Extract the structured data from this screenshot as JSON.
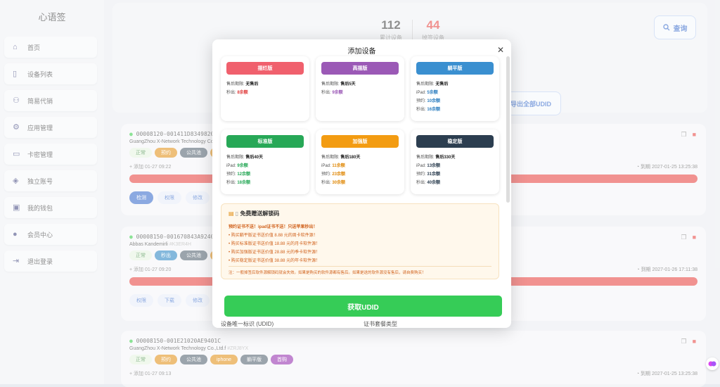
{
  "sidebar": {
    "brand": "心语签",
    "items": [
      {
        "label": "首页",
        "icon": "home-icon"
      },
      {
        "label": "设备列表",
        "icon": "phone-icon"
      },
      {
        "label": "简易代销",
        "icon": "users-icon"
      },
      {
        "label": "应用管理",
        "icon": "apps-icon"
      },
      {
        "label": "卡密管理",
        "icon": "card-icon"
      },
      {
        "label": "独立账号",
        "icon": "layers-icon"
      },
      {
        "label": "我的钱包",
        "icon": "wallet-icon"
      },
      {
        "label": "会员中心",
        "icon": "user-icon"
      },
      {
        "label": "退出登录",
        "icon": "logout-icon"
      }
    ]
  },
  "stats": {
    "total": {
      "value": "112",
      "label": "累计设备"
    },
    "dropped": {
      "value": "44",
      "label": "掉签设备"
    }
  },
  "buttons": {
    "query": "查询",
    "export": "导出全部UDID"
  },
  "devices": [
    {
      "id": "00008120-001411D834982015",
      "company": "GuangZhou X-Network Technology Co.,Ltd.f",
      "tags": [
        {
          "t": "正常",
          "c": "#7cc46f",
          "fg": "#2e7d32",
          "light": true
        },
        {
          "t": "预约",
          "c": "#e08a0b"
        },
        {
          "t": "公共池",
          "c": "#4a5a68"
        },
        {
          "t": "",
          "c": "#e08a0b"
        }
      ],
      "added": "+ 添加 01-27 09:22",
      "expire": "到期 2027-01-25 13:25:38",
      "btns": [
        "检测",
        "权限",
        "修改"
      ]
    },
    {
      "id": "00008150-001670843A924015",
      "company": "Abbas Kandemirli",
      "company_code": "#K3ER4H",
      "tags": [
        {
          "t": "正常",
          "c": "#7cc46f",
          "fg": "#2e7d32",
          "light": true
        },
        {
          "t": "秒出",
          "c": "#1f7fbf"
        },
        {
          "t": "公共池",
          "c": "#4a5a68"
        },
        {
          "t": "",
          "c": "#e08a0b"
        }
      ],
      "added": "+ 添加 01-27 09:20",
      "expire": "到期 2027-01-26 17:11:38",
      "btns": [
        "权限",
        "下载",
        "修改"
      ]
    },
    {
      "id": "00008150-001E21020AE9401C",
      "company": "GuangZhou X-Network Technology Co.,Ltd.f",
      "company_code": "#ZRJ8YX",
      "tags": [
        {
          "t": "正常",
          "c": "#7cc46f",
          "fg": "#2e7d32",
          "light": true
        },
        {
          "t": "预约",
          "c": "#e08a0b"
        },
        {
          "t": "公共池",
          "c": "#4a5a68"
        },
        {
          "t": "iphone",
          "c": "#e08a0b"
        },
        {
          "t": "躺平版",
          "c": "#4a5a68"
        },
        {
          "t": "首购",
          "c": "#8e24aa"
        }
      ],
      "added": "+ 添加 01-27 09:13",
      "expire": "到期 2027-01-25 13:25:38"
    }
  ],
  "modal": {
    "title": "添加设备",
    "plans": [
      {
        "name": "摆烂版",
        "color": "#f0606d",
        "lines": [
          [
            "售后期限:",
            "无售后",
            "#222"
          ],
          [
            "秒出:",
            "8余额",
            "#e04040"
          ]
        ]
      },
      {
        "name": "高摆版",
        "color": "#9b59b6",
        "lines": [
          [
            "售后期限:",
            "售后5天",
            "#222"
          ],
          [
            "秒出:",
            "9余额",
            "#9b59b6"
          ]
        ]
      },
      {
        "name": "躺平版",
        "color": "#3a8fd0",
        "lines": [
          [
            "售后期限:",
            "无售后",
            "#222"
          ],
          [
            "iPad:",
            "5余额",
            "#2f7fc0"
          ],
          [
            "预约:",
            "10余额",
            "#2f7fc0"
          ],
          [
            "秒出:",
            "16余额",
            "#2f7fc0"
          ]
        ]
      },
      {
        "name": "标准版",
        "color": "#27a857",
        "lines": [
          [
            "售后期限:",
            "售后40天",
            "#222"
          ],
          [
            "iPad:",
            "9余额",
            "#27a857"
          ],
          [
            "预约:",
            "12余额",
            "#27a857"
          ],
          [
            "秒出:",
            "18余额",
            "#27a857"
          ]
        ]
      },
      {
        "name": "加强版",
        "color": "#f39c12",
        "lines": [
          [
            "售后期限:",
            "售后180天",
            "#222"
          ],
          [
            "iPad:",
            "11余额",
            "#e08a0b"
          ],
          [
            "预约:",
            "23余额",
            "#e08a0b"
          ],
          [
            "秒出:",
            "30余额",
            "#e08a0b"
          ]
        ]
      },
      {
        "name": "稳定版",
        "color": "#2c3e50",
        "lines": [
          [
            "售后期限:",
            "售后330天",
            "#222"
          ],
          [
            "iPad:",
            "13余额",
            "#2c3e50"
          ],
          [
            "预约:",
            "31余额",
            "#2c3e50"
          ],
          [
            "秒出:",
            "40余额",
            "#2c3e50"
          ]
        ]
      }
    ],
    "gift": {
      "title": "免费赠送解锁码",
      "warn": "预约证书不送！ipad证书不送！只送苹果秒出！",
      "items": [
        "• 购买躺平版证书送价值 8.88 元的周卡软件源！",
        "• 购买标准版证书送价值 18.88 元的月卡软件源！",
        "• 购买加强版证书送价值 28.88 元的季卡软件源！",
        "• 购买稳定版证书送价值 38.88 元的年卡软件源！"
      ],
      "note": "注：一般掉签后软件源解锁码就会失效。如果是购买的软件源都有售后。如果是送的软件源没有售后，请自费购买！"
    },
    "udid_button": "获取UDID",
    "field_udid": "设备唯一标识 (UDID)",
    "field_type": "证书套餐类型"
  }
}
